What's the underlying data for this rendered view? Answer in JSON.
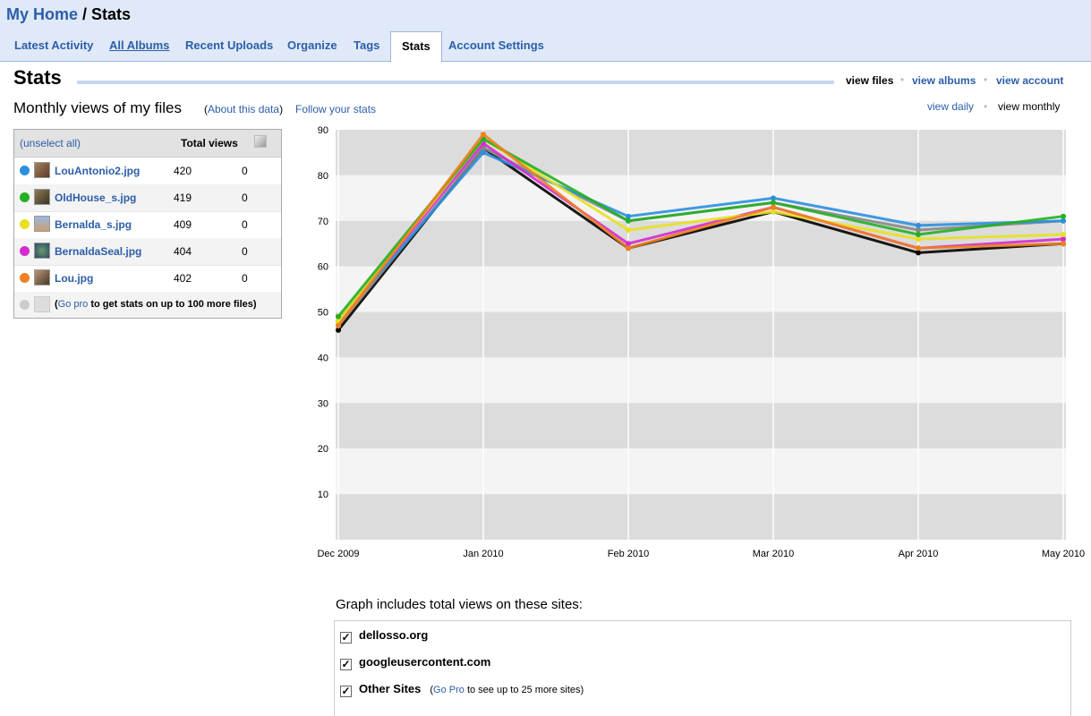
{
  "header": {
    "home_link": "My Home",
    "separator": " / ",
    "page": "Stats"
  },
  "tabs": [
    {
      "label": "Latest Activity"
    },
    {
      "label": "All Albums"
    },
    {
      "label": "Recent Uploads"
    },
    {
      "label": "Organize"
    },
    {
      "label": "Tags"
    },
    {
      "label": "Stats",
      "active": true
    },
    {
      "label": "Account Settings"
    }
  ],
  "stats": {
    "title": "Stats",
    "view_files": "view files",
    "view_albums": "view albums",
    "view_account": "view account",
    "subtitle": "Monthly views of my files",
    "about_open": "(",
    "about_link": "About this data",
    "about_close": ")",
    "follow": "Follow your stats",
    "view_daily": "view daily",
    "view_monthly": "view monthly"
  },
  "files_table": {
    "unselect": "(unselect all)",
    "total_header": "Total views",
    "rows": [
      {
        "name": "LouAntonio2.jpg",
        "total": "420",
        "other": "0",
        "color": "#2b8fe0"
      },
      {
        "name": "OldHouse_s.jpg",
        "total": "419",
        "other": "0",
        "color": "#22b022"
      },
      {
        "name": "Bernalda_s.jpg",
        "total": "409",
        "other": "0",
        "color": "#e8e022"
      },
      {
        "name": "BernaldaSeal.jpg",
        "total": "404",
        "other": "0",
        "color": "#d42bd0"
      },
      {
        "name": "Lou.jpg",
        "total": "402",
        "other": "0",
        "color": "#f08020"
      }
    ],
    "gopro_open": "(",
    "gopro_link": "Go pro",
    "gopro_text": " to get stats on up to 100 more files)"
  },
  "chart_data": {
    "type": "line",
    "categories": [
      "Dec 2009",
      "Jan 2010",
      "Feb 2010",
      "Mar 2010",
      "Apr 2010",
      "May 2010"
    ],
    "ylim": [
      0,
      90
    ],
    "yticks": [
      10,
      20,
      30,
      40,
      50,
      60,
      70,
      80,
      90
    ],
    "grid": true,
    "series": [
      {
        "color": "#000000",
        "values": [
          46,
          86,
          64,
          72,
          63,
          65
        ]
      },
      {
        "color": "#888888",
        "values": [
          47,
          86,
          70,
          74,
          68,
          70
        ]
      },
      {
        "color": "#2b8fe0",
        "values": [
          48,
          85,
          71,
          75,
          69,
          70
        ]
      },
      {
        "color": "#d42bd0",
        "values": [
          48,
          87,
          65,
          73,
          64,
          66
        ]
      },
      {
        "color": "#e8e022",
        "values": [
          48,
          88,
          68,
          72,
          66,
          67
        ]
      },
      {
        "color": "#22b022",
        "values": [
          49,
          88,
          70,
          74,
          67,
          71
        ]
      },
      {
        "color": "#f08020",
        "values": [
          47,
          89,
          64,
          73,
          64,
          65
        ]
      }
    ]
  },
  "sites": {
    "title": "Graph includes total views on these sites:",
    "items": [
      {
        "label": "dellosso.org",
        "checked": "✓"
      },
      {
        "label": "googleusercontent.com",
        "checked": "✓"
      },
      {
        "label": "Other Sites",
        "checked": "✓"
      }
    ],
    "note_open": "(",
    "note_link": "Go Pro",
    "note_text": " to see up to 25 more sites)"
  }
}
